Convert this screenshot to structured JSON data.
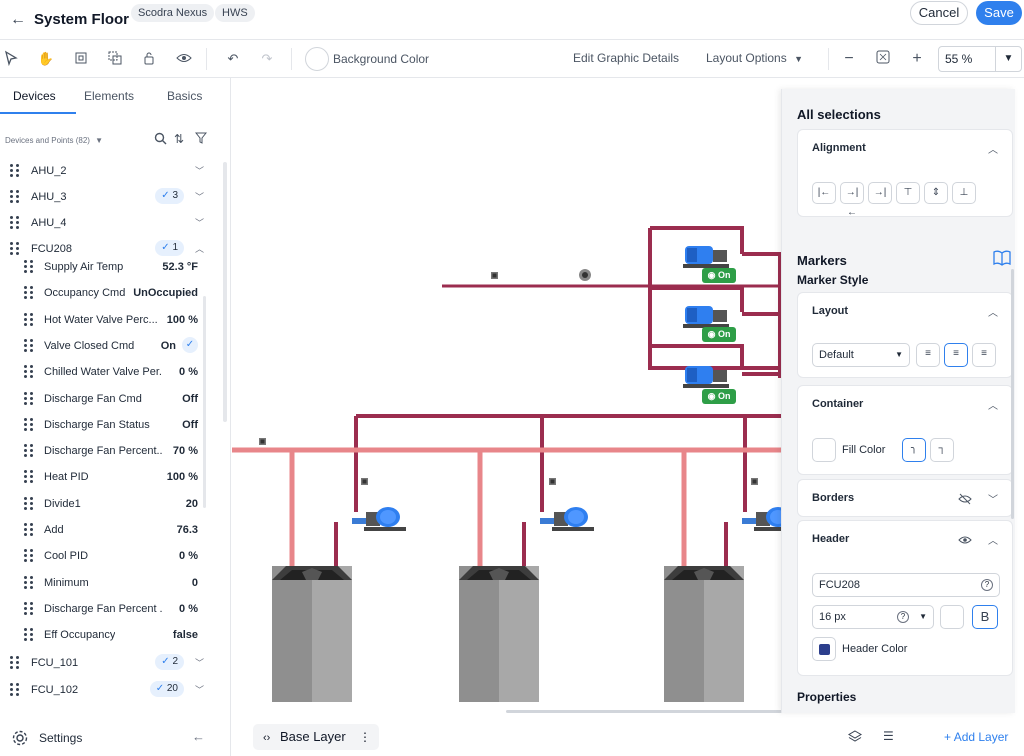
{
  "header": {
    "title": "System Floor",
    "chips": [
      "Scodra Nexus",
      "HWS"
    ],
    "cancel_label": "Cancel",
    "save_label": "Save"
  },
  "toolbar": {
    "background_color_label": "Background Color",
    "edit_graphic_details": "Edit Graphic Details",
    "layout_options": "Layout Options",
    "zoom": "55 %"
  },
  "left_panel": {
    "tabs": [
      "Devices",
      "Elements",
      "Basics"
    ],
    "active_tab": "Devices",
    "devices_header": "Devices and Points (82)",
    "devices": [
      {
        "name": "AHU_2",
        "badge": "",
        "expanded": false
      },
      {
        "name": "AHU_3",
        "badge": "3",
        "expanded": false
      },
      {
        "name": "AHU_4",
        "badge": "",
        "expanded": false
      },
      {
        "name": "FCU208",
        "badge": "1",
        "expanded": true
      }
    ],
    "points": [
      {
        "label": "Supply Air Temp",
        "value": "52.3 °F"
      },
      {
        "label": "Occupancy Cmd",
        "value": "UnOccupied"
      },
      {
        "label": "Hot Water Valve Perc...",
        "value": "100 %"
      },
      {
        "label": "Valve Closed Cmd",
        "value": "On",
        "checked": true
      },
      {
        "label": "Chilled Water Valve Per...",
        "value": "0 %"
      },
      {
        "label": "Discharge Fan Cmd",
        "value": "Off"
      },
      {
        "label": "Discharge Fan Status",
        "value": "Off"
      },
      {
        "label": "Discharge Fan Percent...",
        "value": "70 %"
      },
      {
        "label": "Heat PID",
        "value": "100 %"
      },
      {
        "label": "Divide1",
        "value": "20"
      },
      {
        "label": "Add",
        "value": "76.3"
      },
      {
        "label": "Cool PID",
        "value": "0 %"
      },
      {
        "label": "Minimum",
        "value": "0"
      },
      {
        "label": "Discharge Fan Percent ...",
        "value": "0 %"
      },
      {
        "label": "Eff Occupancy",
        "value": "false"
      }
    ],
    "devices_after": [
      {
        "name": "FCU_101",
        "badge": "2"
      },
      {
        "name": "FCU_102",
        "badge": "20"
      }
    ],
    "settings_label": "Settings"
  },
  "canvas": {
    "pump_status": [
      "On",
      "On",
      "On"
    ]
  },
  "right_panel": {
    "title": "All selections",
    "alignment": {
      "title": "Alignment"
    },
    "markers_title": "Markers",
    "marker_style_title": "Marker Style",
    "layout": {
      "title": "Layout",
      "select_value": "Default"
    },
    "container": {
      "title": "Container",
      "fill_color_label": "Fill Color"
    },
    "borders": {
      "title": "Borders"
    },
    "header": {
      "title": "Header",
      "text_value": "FCU208",
      "font_size": "16 px",
      "bold_label": "B",
      "header_color_label": "Header Color",
      "header_color": "#2c3e8c"
    },
    "properties_title": "Properties"
  },
  "bottom": {
    "base_layer": "Base Layer",
    "add_layer": "Add Layer"
  },
  "colors": {
    "accent": "#2f80ed",
    "pipe_return": "#9b2d4f",
    "pipe_supply": "#e8868a",
    "status_on": "#2e9e47"
  }
}
